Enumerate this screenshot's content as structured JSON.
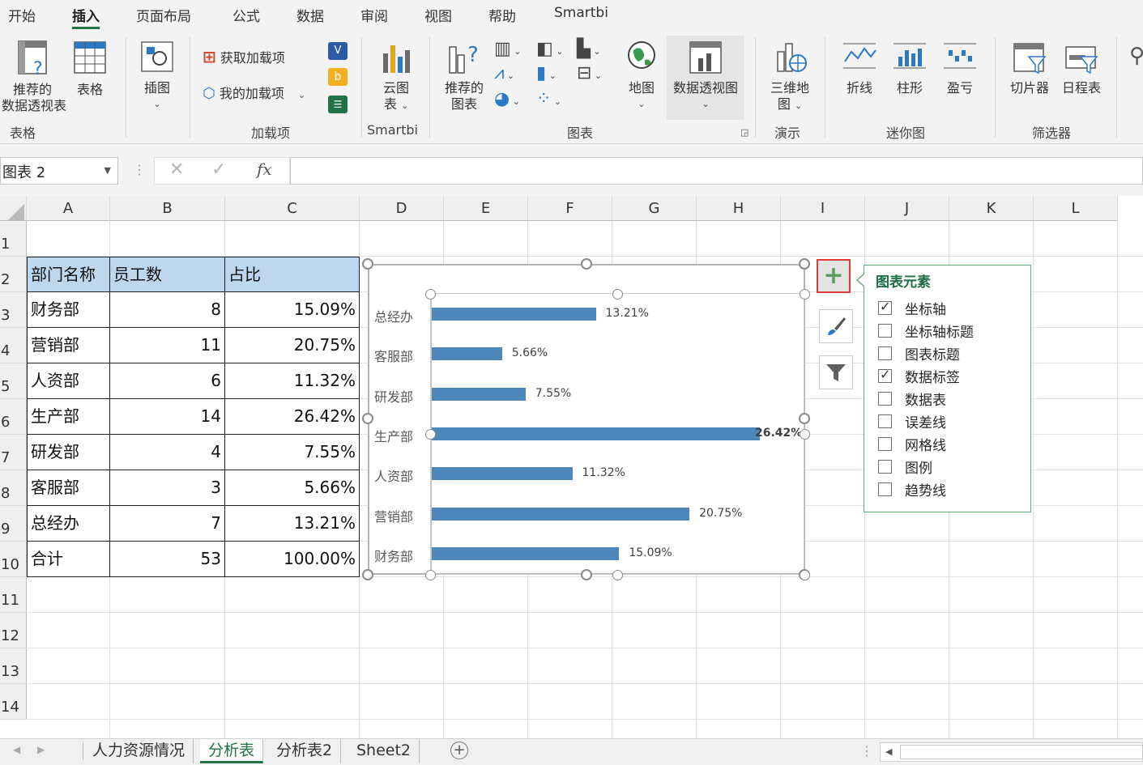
{
  "ribbon_tabs": [
    "开始",
    "插入",
    "页面布局",
    "公式",
    "数据",
    "审阅",
    "视图",
    "帮助",
    "Smartbi"
  ],
  "ribbon": {
    "rec_pivot_l1": "推荐的",
    "rec_pivot_l2": "数据透视表",
    "table": "表格",
    "illustrations": "插图",
    "get_addins": "获取加载项",
    "my_addins": "我的加载项",
    "cloud_chart_l1": "云图",
    "cloud_chart_l2": "表",
    "rec_chart_l1": "推荐的",
    "rec_chart_l2": "图表",
    "map": "地图",
    "pivot_chart": "数据透视图",
    "map3d_l1": "三维地",
    "map3d_l2": "图",
    "spark_line": "折线",
    "spark_column": "柱形",
    "spark_winloss": "盈亏",
    "slicer": "切片器",
    "timeline": "日程表",
    "groups": {
      "tables": "表格",
      "addins": "加载项",
      "smartbi": "Smartbi",
      "charts": "图表",
      "tours": "演示",
      "sparklines": "迷你图",
      "filters": "筛选器"
    }
  },
  "name_box": "图表 2",
  "columns": [
    "A",
    "B",
    "C",
    "D",
    "E",
    "F",
    "G",
    "H",
    "I",
    "J",
    "K",
    "L"
  ],
  "rows": [
    "1",
    "2",
    "3",
    "4",
    "5",
    "6",
    "7",
    "8",
    "9",
    "10",
    "11",
    "12",
    "13",
    "14"
  ],
  "table": {
    "headers": [
      "部门名称",
      "员工数",
      "占比"
    ],
    "rows": [
      [
        "财务部",
        "8",
        "15.09%"
      ],
      [
        "营销部",
        "11",
        "20.75%"
      ],
      [
        "人资部",
        "6",
        "11.32%"
      ],
      [
        "生产部",
        "14",
        "26.42%"
      ],
      [
        "研发部",
        "4",
        "7.55%"
      ],
      [
        "客服部",
        "3",
        "5.66%"
      ],
      [
        "总经办",
        "7",
        "13.21%"
      ],
      [
        "合计",
        "53",
        "100.00%"
      ]
    ]
  },
  "chart_data": {
    "type": "bar",
    "orientation": "horizontal",
    "categories": [
      "总经办",
      "客服部",
      "研发部",
      "生产部",
      "人资部",
      "营销部",
      "财务部"
    ],
    "values": [
      13.21,
      5.66,
      7.55,
      26.42,
      11.32,
      20.75,
      15.09
    ],
    "labels": [
      "13.21%",
      "5.66%",
      "7.55%",
      "26.42%",
      "11.32%",
      "20.75%",
      "15.09%"
    ],
    "xlim": [
      0,
      26.42
    ],
    "color": "#4e88bb",
    "legend": "none",
    "grid": false
  },
  "chart_elements_pane": {
    "title": "图表元素",
    "items": [
      {
        "label": "坐标轴",
        "checked": true
      },
      {
        "label": "坐标轴标题",
        "checked": false
      },
      {
        "label": "图表标题",
        "checked": false
      },
      {
        "label": "数据标签",
        "checked": true
      },
      {
        "label": "数据表",
        "checked": false
      },
      {
        "label": "误差线",
        "checked": false
      },
      {
        "label": "网格线",
        "checked": false
      },
      {
        "label": "图例",
        "checked": false
      },
      {
        "label": "趋势线",
        "checked": false
      }
    ]
  },
  "sheet_tabs": [
    "人力资源情况",
    "分析表",
    "分析表2",
    "Sheet2"
  ],
  "active_sheet": "分析表",
  "colors": {
    "accent": "#217346",
    "header_fill": "#bdd7ee",
    "highlight_border": "#e03b3b"
  }
}
